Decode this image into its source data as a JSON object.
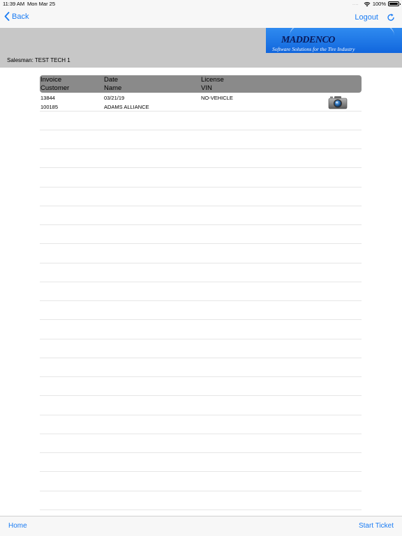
{
  "status": {
    "time": "11:39 AM",
    "date": "Mon Mar 25",
    "signal": "....",
    "battery": "100%"
  },
  "nav": {
    "back_label": "Back",
    "logout_label": "Logout"
  },
  "logo": {
    "name": "MADDENCO",
    "tagline": "Software Solutions for the Tire Industry"
  },
  "salesman_line": "Salesman: TEST TECH 1",
  "table": {
    "headers": {
      "col1_top": "Invoice",
      "col1_bottom": "Customer",
      "col2_top": "Date",
      "col2_bottom": "Name",
      "col3_top": "License",
      "col3_bottom": "VIN"
    },
    "rows": [
      {
        "invoice": "13844",
        "date": "03/21/19",
        "license": "NO-VEHICLE",
        "customer": "100185",
        "name": "ADAMS ALLIANCE"
      }
    ]
  },
  "footer": {
    "home_label": "Home",
    "start_ticket_label": "Start Ticket"
  },
  "colors": {
    "accent": "#1a7cf4",
    "banner_bg": "#c7c7c7",
    "table_header_bg": "#8a8a8a",
    "logo_bg": "#1f75e6"
  }
}
